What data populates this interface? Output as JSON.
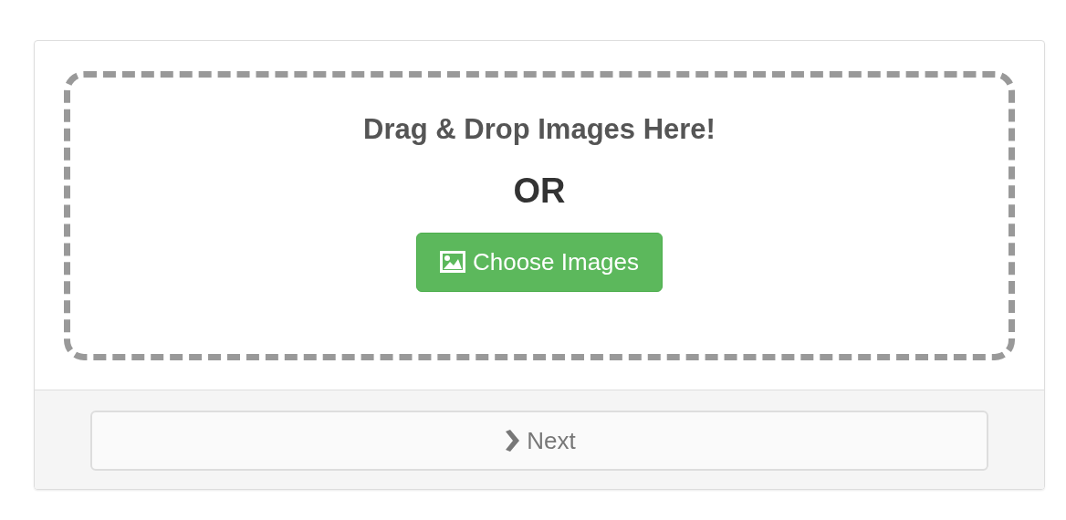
{
  "dropzone": {
    "heading": "Drag & Drop Images Here!",
    "separator": "OR",
    "choose_button": {
      "label": "Choose Images"
    }
  },
  "footer": {
    "next_button": {
      "label": "Next",
      "disabled": true
    }
  }
}
